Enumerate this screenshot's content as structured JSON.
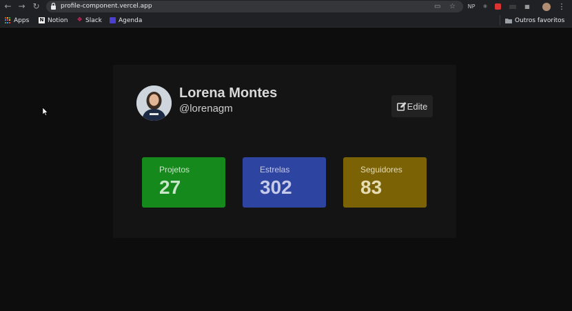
{
  "browser": {
    "url": "profile-component.vercel.app",
    "extensions": [
      "NP"
    ],
    "bookmarks": [
      {
        "label": "Apps",
        "icon": "apps-grid-icon"
      },
      {
        "label": "Notion",
        "icon": "notion-icon"
      },
      {
        "label": "Slack",
        "icon": "slack-icon"
      },
      {
        "label": "Agenda",
        "icon": "calendar-icon"
      }
    ],
    "other_bookmarks": "Outros favoritos"
  },
  "profile": {
    "name": "Lorena Montes",
    "handle": "@lorenagm",
    "edit_label": "Edite",
    "stats": [
      {
        "label": "Projetos",
        "value": "27",
        "color": "#15891c",
        "text_color": "#c8e6c9"
      },
      {
        "label": "Estrelas",
        "value": "302",
        "color": "#2e44a1",
        "text_color": "#c5cae9"
      },
      {
        "label": "Seguidores",
        "value": "83",
        "color": "#7a6205",
        "text_color": "#e6dcb4"
      }
    ]
  }
}
